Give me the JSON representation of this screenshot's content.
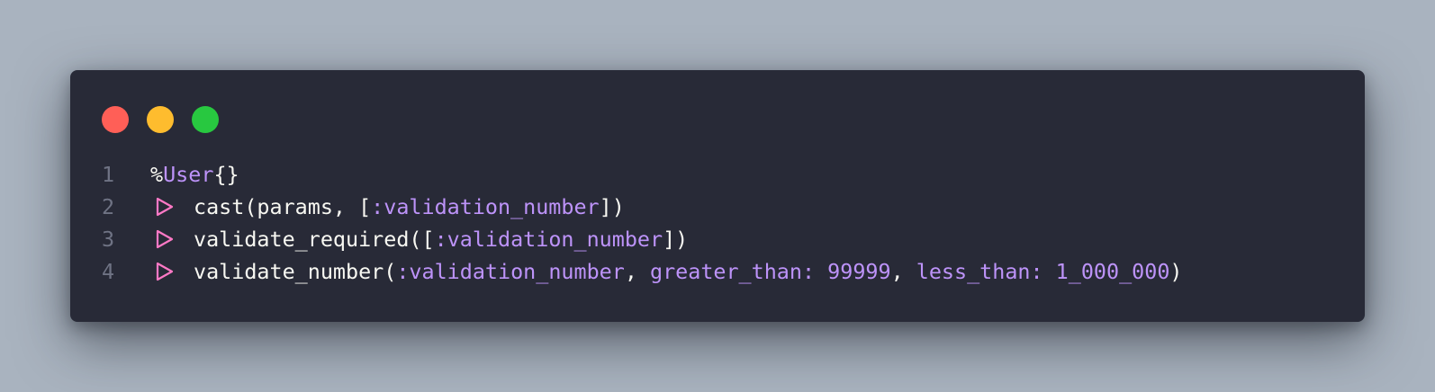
{
  "window": {
    "background": "#282a37",
    "controls": [
      {
        "name": "close",
        "color": "#ff5f57"
      },
      {
        "name": "minimize",
        "color": "#febc2e"
      },
      {
        "name": "maximize",
        "color": "#28c840"
      }
    ]
  },
  "code": {
    "language": "elixir",
    "lines": [
      {
        "number": "1",
        "pipe": false,
        "tokens": [
          {
            "text": "%",
            "kind": "plain"
          },
          {
            "text": "User",
            "kind": "mod"
          },
          {
            "text": "{}",
            "kind": "plain"
          }
        ]
      },
      {
        "number": "2",
        "pipe": true,
        "tokens": [
          {
            "text": "cast(params, [",
            "kind": "plain"
          },
          {
            "text": ":validation_number",
            "kind": "atom"
          },
          {
            "text": "])",
            "kind": "plain"
          }
        ]
      },
      {
        "number": "3",
        "pipe": true,
        "tokens": [
          {
            "text": "validate_required([",
            "kind": "plain"
          },
          {
            "text": ":validation_number",
            "kind": "atom"
          },
          {
            "text": "])",
            "kind": "plain"
          }
        ]
      },
      {
        "number": "4",
        "pipe": true,
        "tokens": [
          {
            "text": "validate_number(",
            "kind": "plain"
          },
          {
            "text": ":validation_number",
            "kind": "atom"
          },
          {
            "text": ", ",
            "kind": "plain"
          },
          {
            "text": "greater_than:",
            "kind": "key"
          },
          {
            "text": " ",
            "kind": "plain"
          },
          {
            "text": "99999",
            "kind": "num"
          },
          {
            "text": ", ",
            "kind": "plain"
          },
          {
            "text": "less_than:",
            "kind": "key"
          },
          {
            "text": " ",
            "kind": "plain"
          },
          {
            "text": "1_000_000",
            "kind": "num"
          },
          {
            "text": ")",
            "kind": "plain"
          }
        ]
      }
    ],
    "pipe_icon": "pipe-triangle-icon",
    "colors": {
      "plain": "#f8f8f2",
      "accent": "#bd93f9",
      "pipe": "#ff79c6",
      "line_number": "#6f7384"
    }
  }
}
